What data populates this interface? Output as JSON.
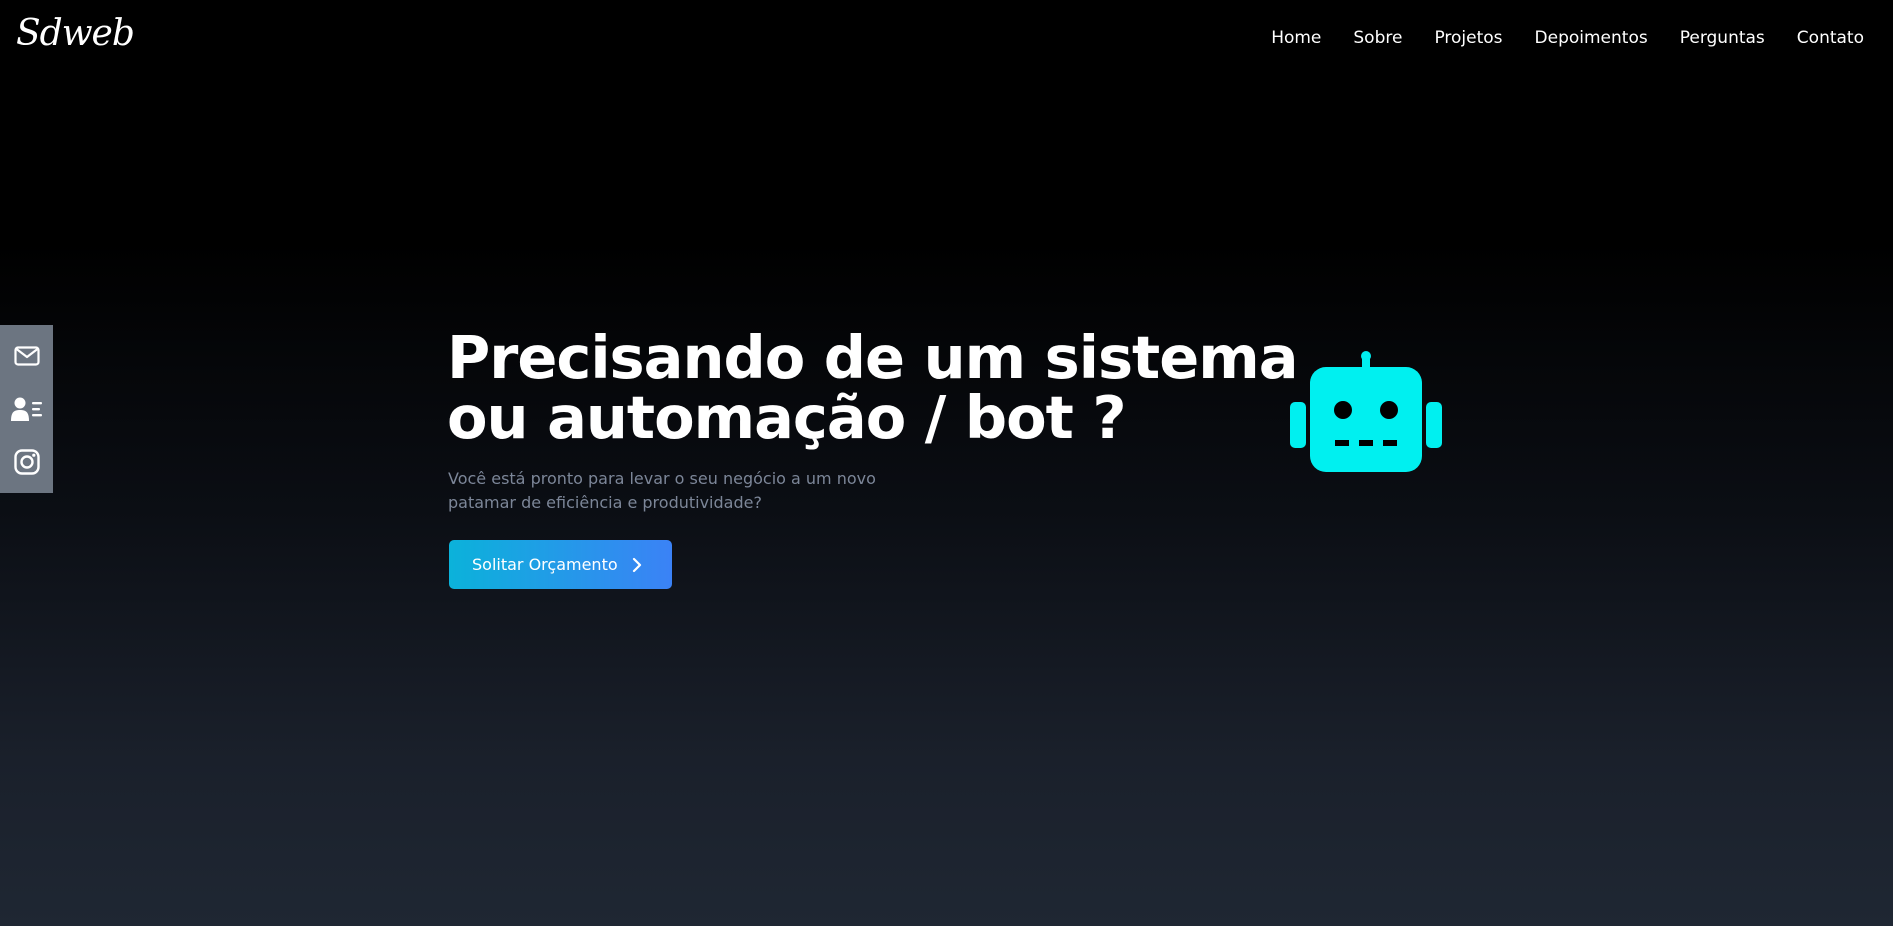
{
  "header": {
    "logo_text": "Sdweb",
    "nav": [
      {
        "label": "Home"
      },
      {
        "label": "Sobre"
      },
      {
        "label": "Projetos"
      },
      {
        "label": "Depoimentos"
      },
      {
        "label": "Perguntas"
      },
      {
        "label": "Contato"
      }
    ]
  },
  "side_bar": {
    "icons": [
      "envelope-icon",
      "contact-card-icon",
      "instagram-icon"
    ]
  },
  "hero": {
    "title_line_1": "Precisando de um sistema",
    "title_line_2": "ou automação / bot ?",
    "text": "Você está pronto para levar o seu negócio a um novo patamar de eficiência e produtividade?",
    "cta_label": "Solitar Orçamento",
    "cta_icon": "chevron-right-icon",
    "illustration": "robot-icon"
  },
  "colors": {
    "background_top": "#000000",
    "background_bottom": "#1f2733",
    "side_bar": "#6c7581",
    "cta_gradient_start": "#0bb2da",
    "cta_gradient_end": "#3b82f6",
    "robot": "#00f0f0",
    "muted_text": "#7c8698"
  }
}
